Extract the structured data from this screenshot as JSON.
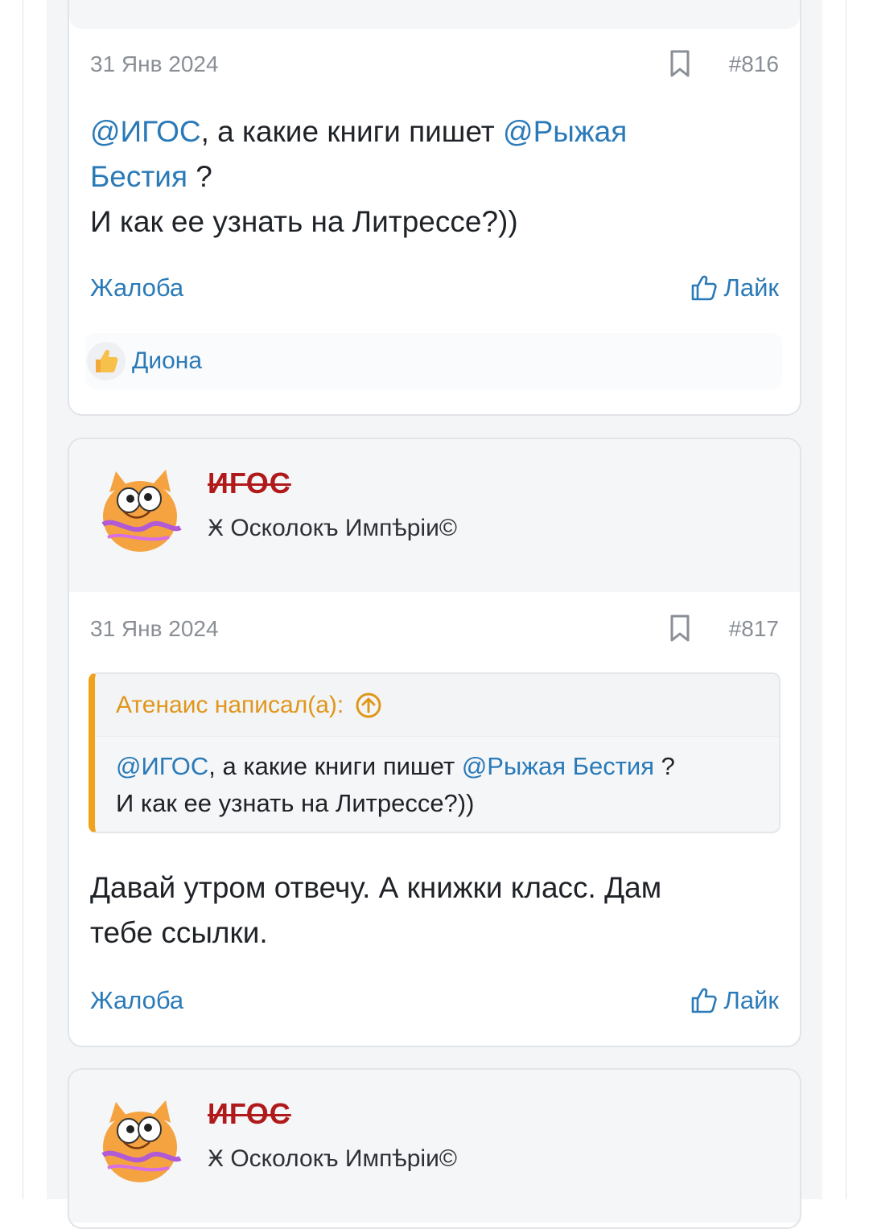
{
  "posts": [
    {
      "date": "31 Янв 2024",
      "number": "#816",
      "body": {
        "mention1": "@ИГОС",
        "text1": ", а какие книги пишет ",
        "mention2a": "@Рыжая",
        "mention2b": "Бестия",
        "text2": " ?",
        "line3": "И как ее узнать на Литрессе?))"
      },
      "report_label": "Жалоба",
      "like_label": "Лайк",
      "liked_by": "Диона"
    },
    {
      "author": "ИГОС",
      "author_title": "Ӿ Осколокъ Импѣріи©",
      "date": "31 Янв 2024",
      "number": "#817",
      "quote": {
        "header": "Атенаис написал(а):",
        "mention1": "@ИГОС",
        "text1": ", а какие книги пишет ",
        "mention2": "@Рыжая Бестия",
        "text2": " ?",
        "line2": "И как ее узнать на Литрессе?))"
      },
      "body_line1": "Давай утром отвечу. А книжки класс. Дам",
      "body_line2": "тебе ссылки.",
      "report_label": "Жалоба",
      "like_label": "Лайк"
    },
    {
      "author": "ИГОС",
      "author_title": "Ӿ Осколокъ Импѣріи©"
    }
  ],
  "colors": {
    "link": "#2a7ab8",
    "author": "#b01a1a",
    "quote_accent": "#f0a31a"
  }
}
